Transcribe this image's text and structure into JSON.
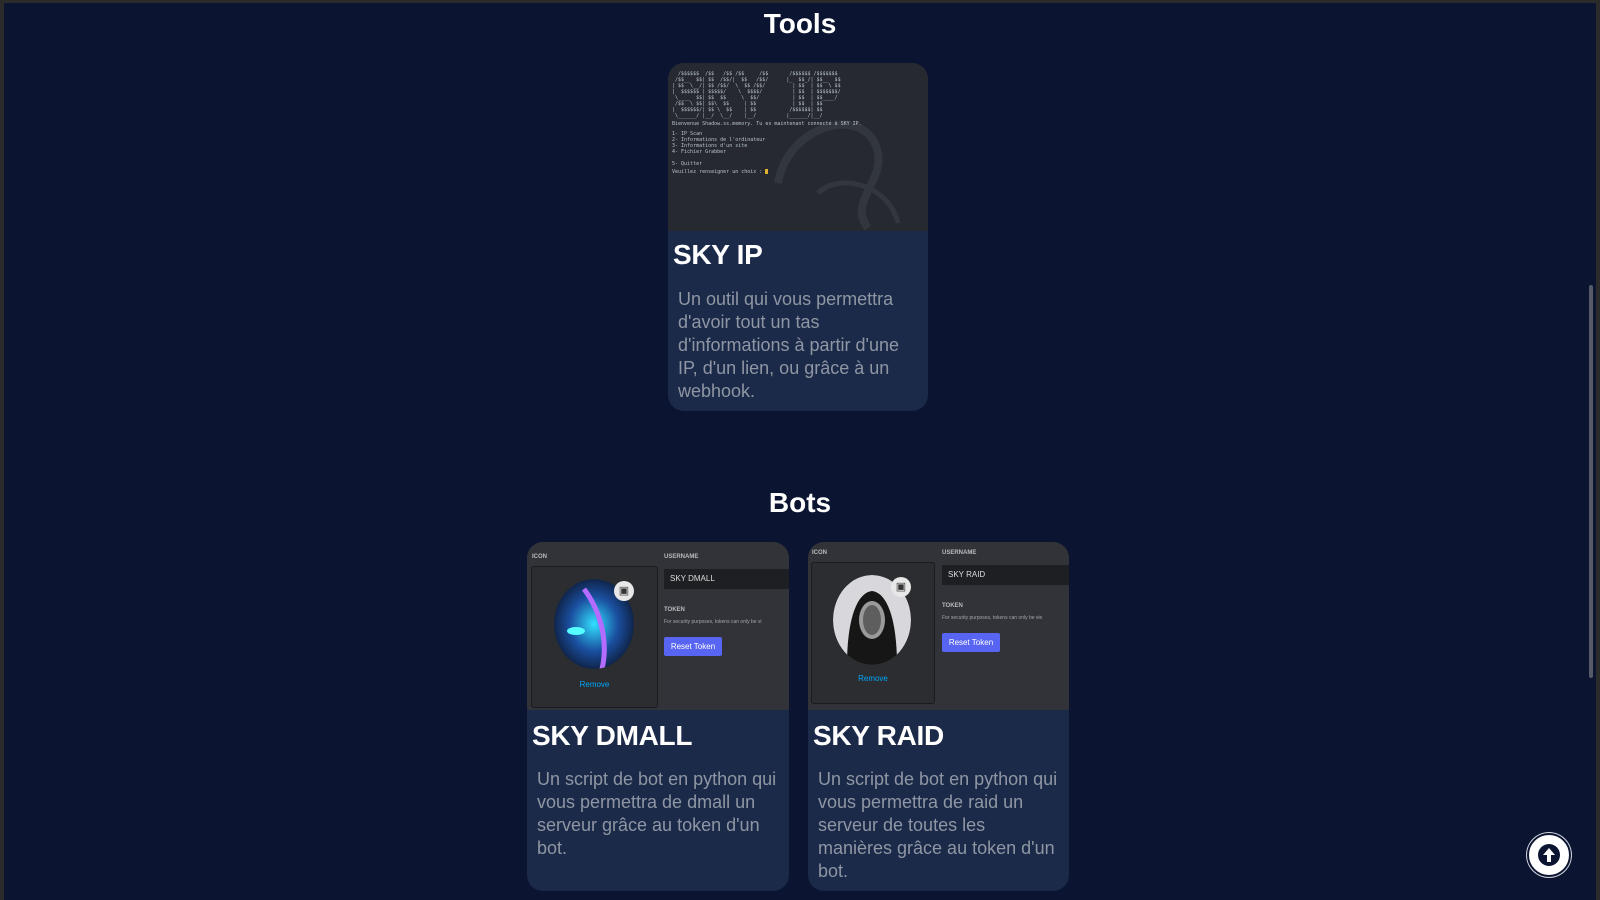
{
  "sections": {
    "tools": {
      "title": "Tools"
    },
    "bots": {
      "title": "Bots"
    }
  },
  "cards": {
    "sky_ip": {
      "title": "SKY IP",
      "description": "Un outil qui vous permettra d'avoir tout un tas d'informations à partir d'une IP, d'un lien, ou grâce à un webhook.",
      "screenshot": {
        "welcome": "Bienvenue Shadow.ss.memory. Tu es maintenant connecté à SKY IP.",
        "menu": [
          "1- IP Scan",
          "2- Informations de l'ordinateur",
          "3- Informations d'un site",
          "4- Fichier Grabber",
          "",
          "5- Quitter"
        ],
        "prompt": "Veuillez renseigner un choix : "
      }
    },
    "sky_dmall": {
      "title": "SKY DMALL",
      "description": "Un script de bot en python qui vous permettra de dmall un serveur grâce au token d'un bot.",
      "screenshot": {
        "icon_label": "ICON",
        "username_label": "USERNAME",
        "username_value": "SKY DMALL",
        "token_label": "TOKEN",
        "token_hint": "For security purposes, tokens can only be vi",
        "reset_label": "Reset Token",
        "remove_label": "Remove"
      }
    },
    "sky_raid": {
      "title": "SKY RAID",
      "description": "Un script de bot en python qui vous permettra de raid un serveur de toutes les manières grâce au token d'un bot.",
      "screenshot": {
        "icon_label": "ICON",
        "username_label": "USERNAME",
        "username_value": "SKY RAID",
        "token_label": "TOKEN",
        "token_hint": "For security purposes, tokens can only be vie",
        "reset_label": "Reset Token",
        "remove_label": "Remove"
      }
    }
  },
  "icons": {
    "scroll_top": "arrow-up-icon",
    "edit_avatar": "image-edit-icon"
  },
  "colors": {
    "page_background": "#0b1430",
    "card_background": "#1c2a4a",
    "discord_blurple": "#5865f2",
    "link_blue": "#00a8fc"
  }
}
